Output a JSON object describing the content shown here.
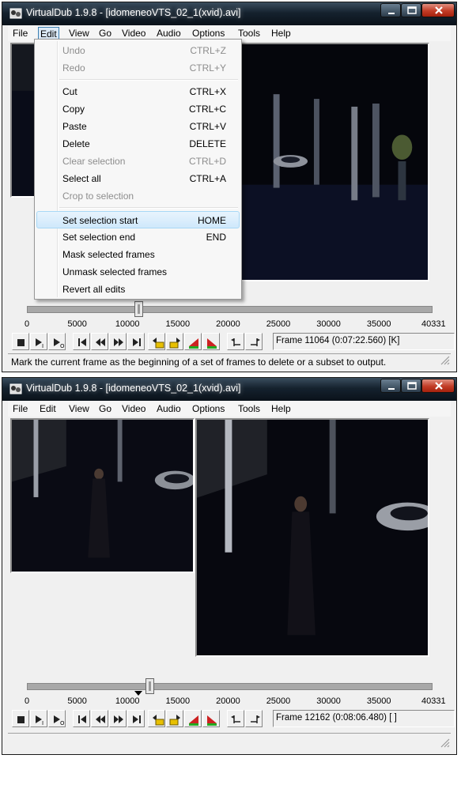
{
  "windows": [
    {
      "title": "VirtualDub 1.9.8 - [idomeneoVTS_02_1(xvid).avi]",
      "menu": [
        "File",
        "Edit",
        "View",
        "Go",
        "Video",
        "Audio",
        "Options",
        "Tools",
        "Help"
      ],
      "active_menu": "Edit",
      "position_value": 11064,
      "frame_label": "Frame 11064 (0:07:22.560) [K]",
      "status_text": "Mark the current frame as the beginning of a set of frames to delete or a subset to output."
    },
    {
      "title": "VirtualDub 1.9.8 - [idomeneoVTS_02_1(xvid).avi]",
      "menu": [
        "File",
        "Edit",
        "View",
        "Go",
        "Video",
        "Audio",
        "Options",
        "Tools",
        "Help"
      ],
      "active_menu": "",
      "position_value": 12162,
      "selection_start_marker": 11064,
      "frame_label": "Frame 12162 (0:08:06.480) [ ]",
      "status_text": ""
    }
  ],
  "timeline_ticks": [
    "0",
    "5000",
    "10000",
    "15000",
    "20000",
    "25000",
    "30000",
    "35000",
    "40331"
  ],
  "edit_menu": [
    {
      "label": "Undo",
      "shortcut": "CTRL+Z",
      "enabled": false
    },
    {
      "label": "Redo",
      "shortcut": "CTRL+Y",
      "enabled": false
    },
    {
      "separator": true
    },
    {
      "label": "Cut",
      "shortcut": "CTRL+X",
      "enabled": true
    },
    {
      "label": "Copy",
      "shortcut": "CTRL+C",
      "enabled": true
    },
    {
      "label": "Paste",
      "shortcut": "CTRL+V",
      "enabled": true
    },
    {
      "label": "Delete",
      "shortcut": "DELETE",
      "enabled": true
    },
    {
      "label": "Clear selection",
      "shortcut": "CTRL+D",
      "enabled": false
    },
    {
      "label": "Select all",
      "shortcut": "CTRL+A",
      "enabled": true
    },
    {
      "label": "Crop to selection",
      "shortcut": "",
      "enabled": false
    },
    {
      "separator": true
    },
    {
      "label": "Set selection start",
      "shortcut": "HOME",
      "enabled": true,
      "highlighted": true
    },
    {
      "label": "Set selection end",
      "shortcut": "END",
      "enabled": true
    },
    {
      "label": "Mask selected frames",
      "shortcut": "",
      "enabled": true
    },
    {
      "label": "Unmask selected frames",
      "shortcut": "",
      "enabled": true
    },
    {
      "label": "Revert all edits",
      "shortcut": "",
      "enabled": true
    }
  ],
  "toolbar_icons": [
    "stop-icon",
    "play-input-icon",
    "play-output-icon",
    "go-start-icon",
    "prev-frame-icon",
    "next-frame-icon",
    "go-end-icon",
    "prev-keyframe-icon",
    "next-keyframe-icon",
    "prev-scene-icon",
    "next-scene-icon",
    "mark-in-icon",
    "mark-out-icon"
  ],
  "colors": {
    "titlebar": "#15222e",
    "menu_highlight": "#cfe8fb",
    "track": "#a8a8a8",
    "key_icon": "#e8c000"
  }
}
